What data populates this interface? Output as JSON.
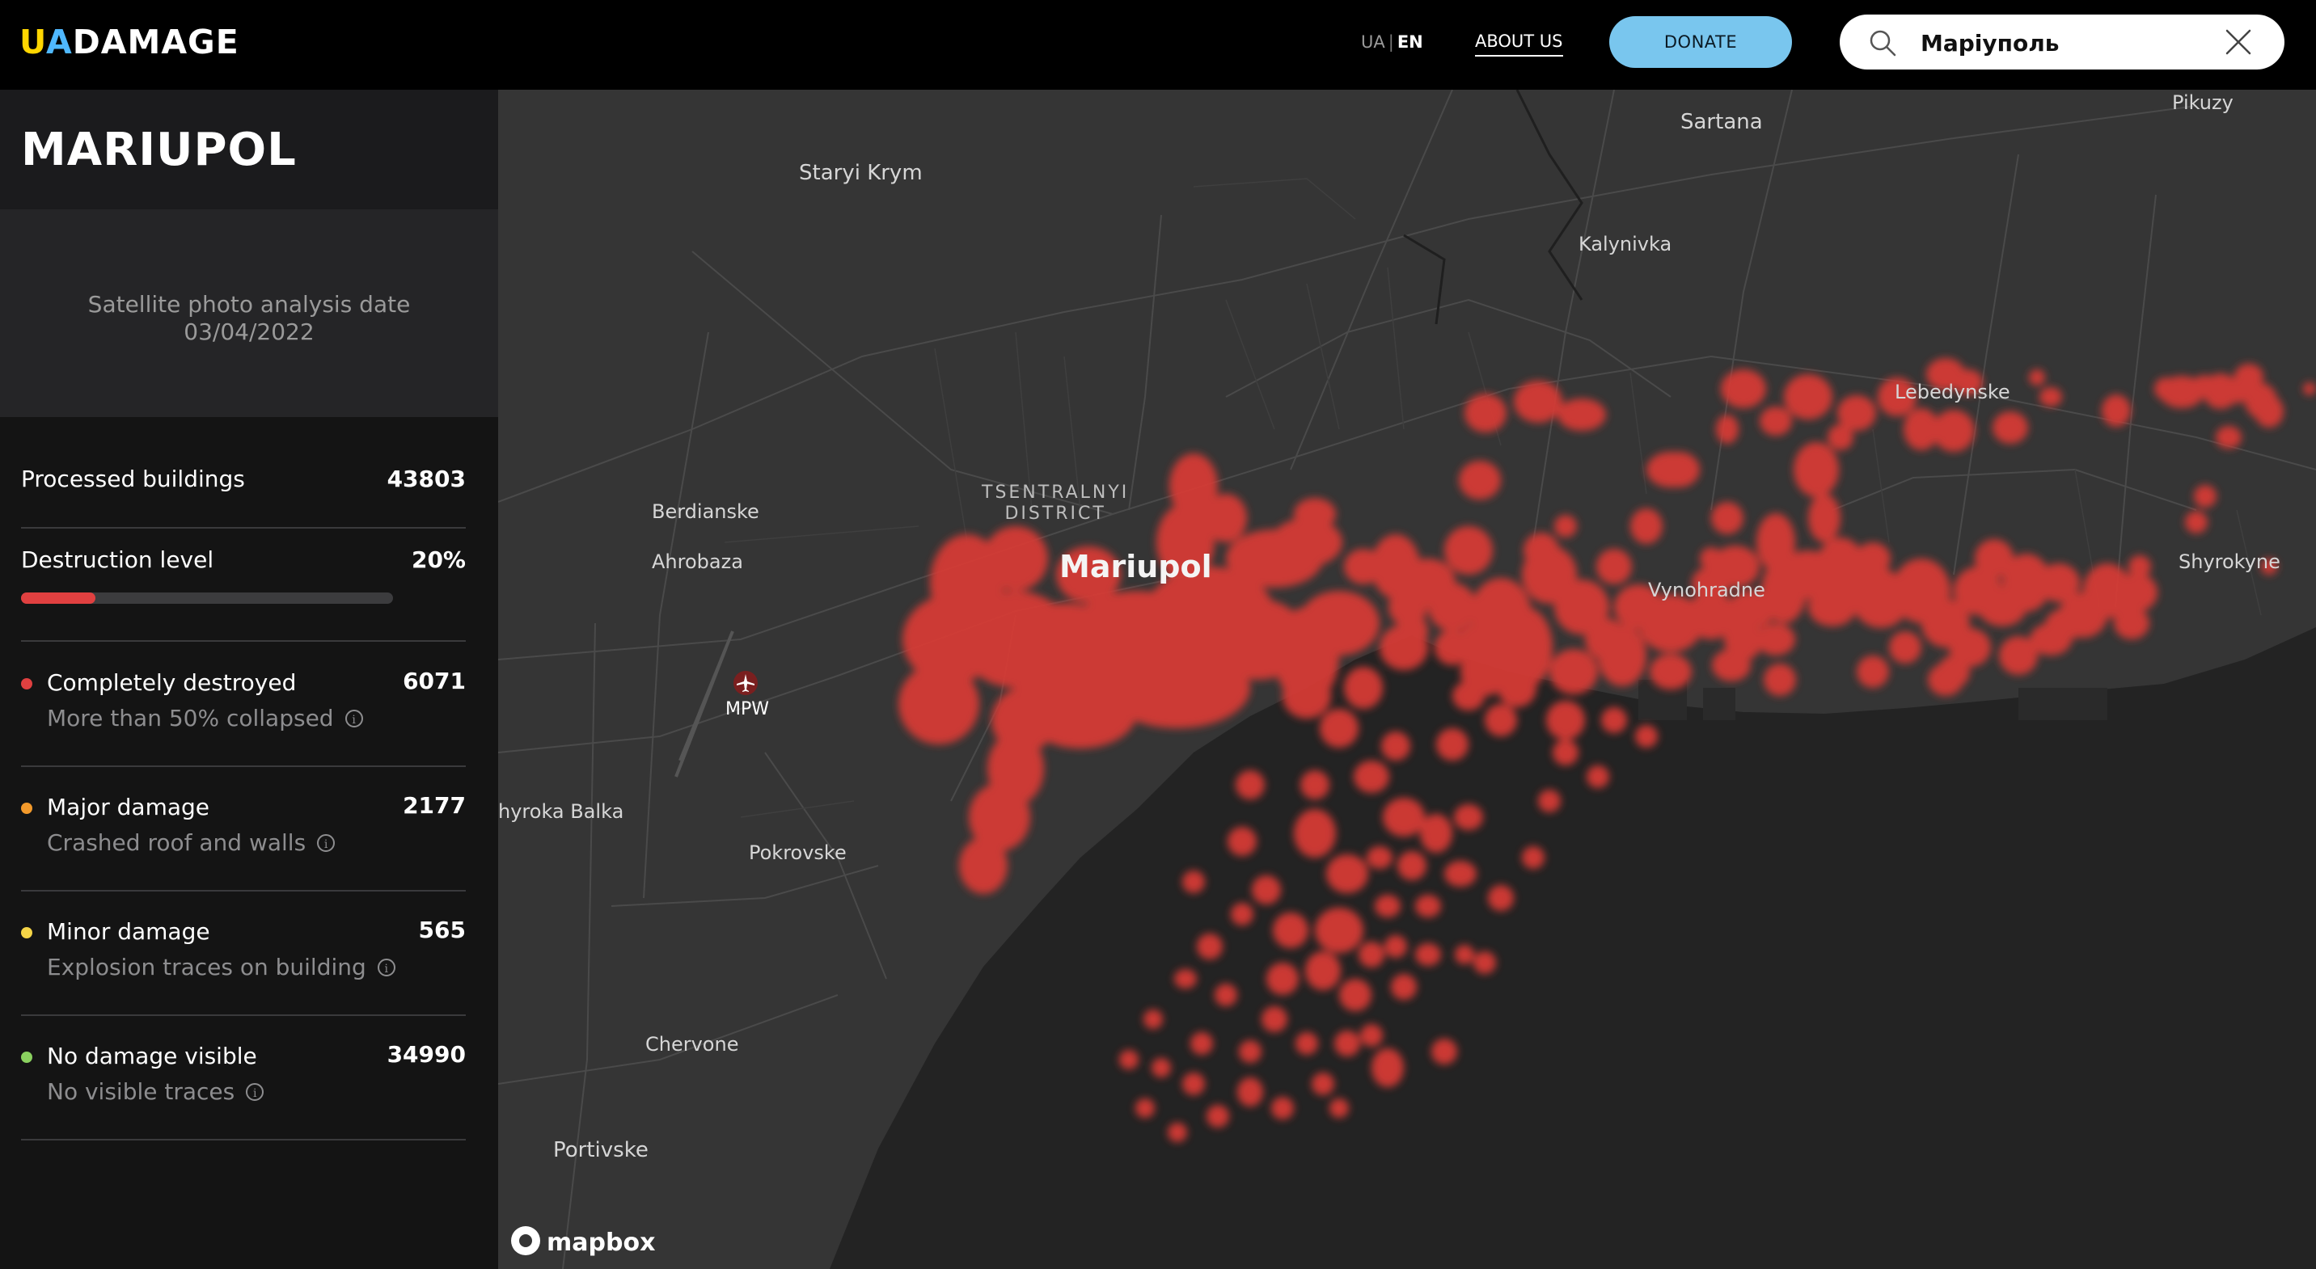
{
  "header": {
    "logo_u": "U",
    "logo_a": "A",
    "logo_rest": "DAMAGE",
    "lang_ua": "UA",
    "lang_sep": "|",
    "lang_en": "EN",
    "about_label": "ABOUT US",
    "donate_label": "DONATE",
    "search_value": "Маріуполь",
    "logo_colors": {
      "u": "#ffd600",
      "a": "#4fb8ff"
    }
  },
  "sidebar": {
    "city": "MARIUPOL",
    "date_caption": "Satellite photo analysis date",
    "date_value": "03/04/2022",
    "processed_label": "Processed buildings",
    "processed_value": "43803",
    "destruction_label": "Destruction level",
    "destruction_value": "20%",
    "destruction_fraction": 0.2,
    "categories": [
      {
        "label": "Completely destroyed",
        "sub": "More than 50% collapsed",
        "value": "6071",
        "color": "#e04040"
      },
      {
        "label": "Major damage",
        "sub": "Crashed roof and walls",
        "value": "2177",
        "color": "#f39a2b"
      },
      {
        "label": "Minor damage",
        "sub": "Explosion traces on building",
        "value": "565",
        "color": "#f5d547"
      },
      {
        "label": "No damage visible",
        "sub": "No visible traces",
        "value": "34990",
        "color": "#8ad15f"
      }
    ]
  },
  "map": {
    "places": {
      "staryi_krym": "Staryi Krym",
      "sartana": "Sartana",
      "pikuzy": "Pikuzy",
      "kalynivka": "Kalynivka",
      "lebedynske": "Lebedynske",
      "district": "TSENTRALNYI\nDISTRICT",
      "berdianske": "Berdianske",
      "ahrobaza": "Ahrobaza",
      "mariupol": "Mariupol",
      "vynohradne": "Vynohradne",
      "shyrokyne": "Shyrokyne",
      "airport": "MPW",
      "shyroka_balka": "hyroka Balka",
      "pokrovske": "Pokrovske",
      "chervone": "Chervone",
      "portivske": "Portivske"
    },
    "attribution": "mapbox",
    "damage_color": "#d83a34"
  }
}
